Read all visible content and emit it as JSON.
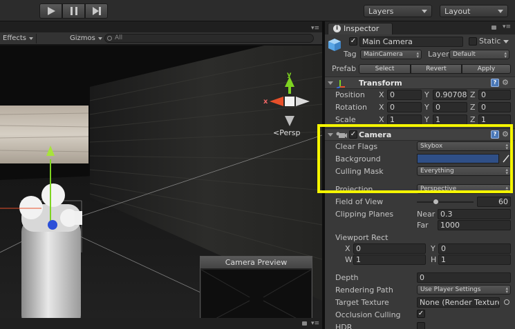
{
  "toolbar": {
    "play_icon": "play-icon",
    "pause_icon": "pause-icon",
    "step_icon": "step-icon",
    "layers_label": "Layers",
    "layout_label": "Layout"
  },
  "scene": {
    "effects_label": "Effects",
    "gizmos_label": "Gizmos",
    "search_placeholder": "All",
    "axis_x": "x",
    "axis_y": "y",
    "persp_label": "Persp",
    "preview_title": "Camera Preview"
  },
  "inspector": {
    "tab_label": "Inspector",
    "object_name": "Main Camera",
    "static_label": "Static",
    "static_checked": false,
    "active_checked": true,
    "tag_label": "Tag",
    "tag_value": "MainCamera",
    "layer_label": "Layer",
    "layer_value": "Default",
    "prefab_label": "Prefab",
    "prefab_buttons": [
      "Select",
      "Revert",
      "Apply"
    ],
    "transform": {
      "title": "Transform",
      "rows": [
        {
          "label": "Position",
          "x": "0",
          "y": "0.90708",
          "z": "0"
        },
        {
          "label": "Rotation",
          "x": "0",
          "y": "0",
          "z": "0"
        },
        {
          "label": "Scale",
          "x": "1",
          "y": "1",
          "z": "1"
        }
      ],
      "axis_labels": [
        "X",
        "Y",
        "Z"
      ]
    },
    "camera": {
      "title": "Camera",
      "enabled": true,
      "clear_flags_label": "Clear Flags",
      "clear_flags_value": "Skybox",
      "background_label": "Background",
      "background_color": "#2f4f87",
      "culling_mask_label": "Culling Mask",
      "culling_mask_value": "Everything",
      "projection_label": "Projection",
      "projection_value": "Perspective",
      "fov_label": "Field of View",
      "fov_value": "60",
      "fov_fraction": 0.33,
      "clipping_label": "Clipping Planes",
      "near_label": "Near",
      "near_value": "0.3",
      "far_label": "Far",
      "far_value": "1000",
      "viewport_label": "Viewport Rect",
      "viewport": {
        "X": "0",
        "Y": "0",
        "W": "1",
        "H": "1"
      },
      "depth_label": "Depth",
      "depth_value": "0",
      "rendering_path_label": "Rendering Path",
      "rendering_path_value": "Use Player Settings",
      "target_texture_label": "Target Texture",
      "target_texture_value": "None (Render Texture)",
      "occlusion_label": "Occlusion Culling",
      "occlusion_checked": true,
      "hdr_label": "HDR",
      "hdr_checked": false
    }
  },
  "colors": {
    "highlight": "#f5f500",
    "axis_x": "#e8502a",
    "axis_y": "#7ed321",
    "axis_z": "#3a6ee8",
    "help_icon": "#4a78b8"
  }
}
